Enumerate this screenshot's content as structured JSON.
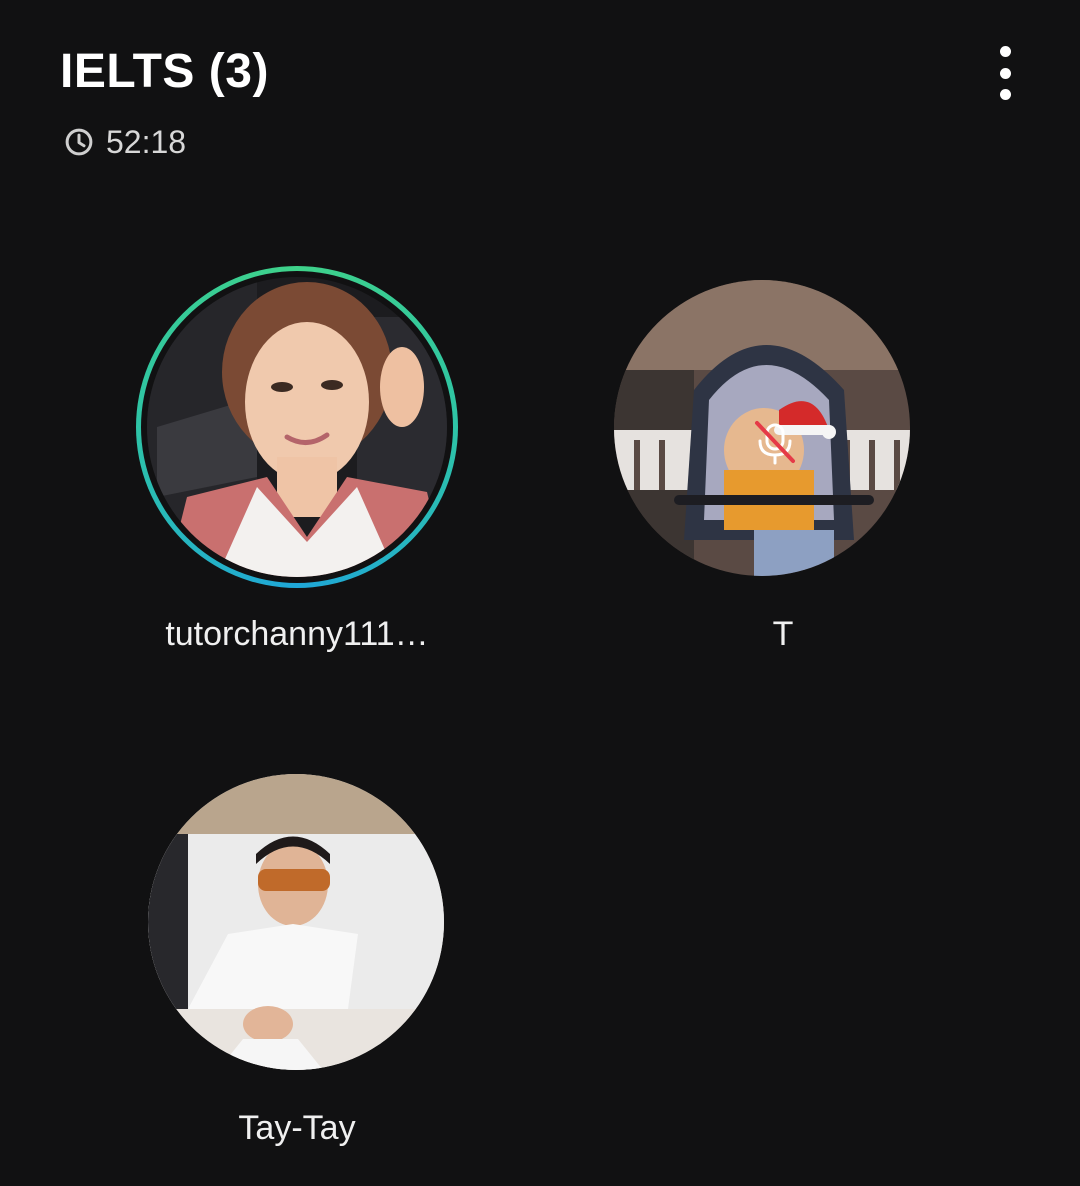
{
  "header": {
    "title": "IELTS (3)",
    "timer_icon": "clock-icon",
    "elapsed": "52:18",
    "more_icon": "more-vertical-icon"
  },
  "participants": [
    {
      "name": "tutorchanny111…",
      "speaking": true,
      "muted": false
    },
    {
      "name": "T",
      "speaking": false,
      "muted": true,
      "mute_icon": "mic-off-icon"
    },
    {
      "name": "Tay-Tay",
      "speaking": false,
      "muted": false
    }
  ],
  "colors": {
    "background": "#111112",
    "speaking_ring_start": "#3fd28a",
    "speaking_ring_end": "#1fa7d8"
  }
}
